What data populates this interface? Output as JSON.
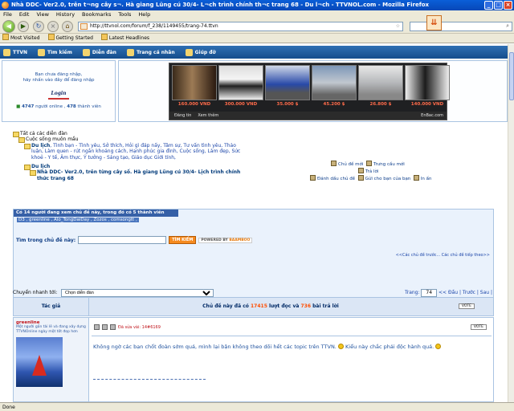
{
  "window": {
    "title": "Nhà DDC- Ver2.0, trên t¬ng cây s¬. Hà giang Lũng cú 30/4- L¬ch trình chính th¬c trang 68 - Du l¬ch - TTVNOL.com - Mozilla Firefox"
  },
  "menu": [
    "File",
    "Edit",
    "View",
    "History",
    "Bookmarks",
    "Tools",
    "Help"
  ],
  "nav": {
    "url": "http://ttvnol.com/forum/f_238/1149455/trang-74.ttvn"
  },
  "bookmarks": [
    "Most Visited",
    "Getting Started",
    "Latest Headlines"
  ],
  "site_nav": [
    "TTVN",
    "Tìm kiếm",
    "Diễn đàn",
    "Trang cá nhân",
    "Giúp đỡ"
  ],
  "login": {
    "line1": "Bạn chưa đăng nhập,",
    "line2": "hãy nhấn vào đây để đăng nhập",
    "logo": "Login",
    "online_count": "4747",
    "online_text": "người online ,",
    "member_count": "478",
    "member_text": "thành viên"
  },
  "ads": {
    "prices": [
      "160.000 VND",
      "300.000 VND",
      "35.000 $",
      "45.200 $",
      "26.800 $",
      "140.000 VND"
    ],
    "footer_post": "Đăng tin",
    "footer_view": "Xem thêm",
    "footer_brand": "EnBac.com"
  },
  "tree": {
    "all_forums": "Tất cả các diễn đàn",
    "sub1": "Cuộc sống muôn mầu",
    "travel": "Du lịch",
    "travel_links": ", Tình bạn - Tình yêu, Sở thích, Hỏi gì đáp nấy, Tâm sự, Tư vấn tình yêu, Thảo luận, Làm quen - rút ngắn khoảng cách, Hạnh phúc gia đình, Cuộc sống, Làm đẹp, Sức khoẻ - Y tế, Âm thực, Ý tưởng - Sáng tạo, Giáo dục Giới tính,",
    "travel2": "Du lịch",
    "thread_title": "Nhà DDC- Ver2.0, trên từng cây số. Hà giang Lũng cú 30/4- Lịch trình chính thức trang 68"
  },
  "tools": {
    "new_topic": "Chủ đề mới",
    "poll": "Trưng cầu mới",
    "reply": "Trả lời",
    "mark": "Đánh dấu chủ đề",
    "send": "Gửi cho bạn của bạn",
    "print": "In ấn"
  },
  "viewers": {
    "header": "Có 14 người đang xem chủ đề này, trong đó có 5 thành viên",
    "names": "D3 , greenline , Alo_TongDaiDay , Zozos , comsongtt ,",
    "search_label": "Tìm trong chủ đề này:",
    "search_btn": "TÌM KIẾM",
    "powered": "POWERED BY",
    "powered_brand": "BAAMBOO",
    "prevnext": "<<Các chủ đề trước... Các chủ đề tiếp theo>>"
  },
  "jump": {
    "label": "Chuyển nhanh tới:",
    "selected": "Chọn diễn đàn",
    "page_label": "Trang:",
    "page": "74",
    "nav": "<< Đầu | Trước | Sau |"
  },
  "thread": {
    "author_col": "Tác giả",
    "stat_pre": "Chủ đề này đã có",
    "views": "17415",
    "stat_mid": "lượt đọc và",
    "replies": "736",
    "stat_post": "bài trả lời",
    "vote": "VOTE"
  },
  "post": {
    "username": "greenline",
    "motto": "Một người gần tài lẻ và đang xây dựng TTVNOnline ngày một tốt đẹp hơn",
    "time": "Đã sửa vài: 14#6169",
    "vote": "VOTE",
    "message": "Không ngờ các bạn chốt đoàn sớm quá, mình lại bận không theo dõi hết các topic trên TTVN.",
    "message2": "Kiểu này chắc phải độc hành quá.",
    "sig_sep": ""
  },
  "status": "Done"
}
